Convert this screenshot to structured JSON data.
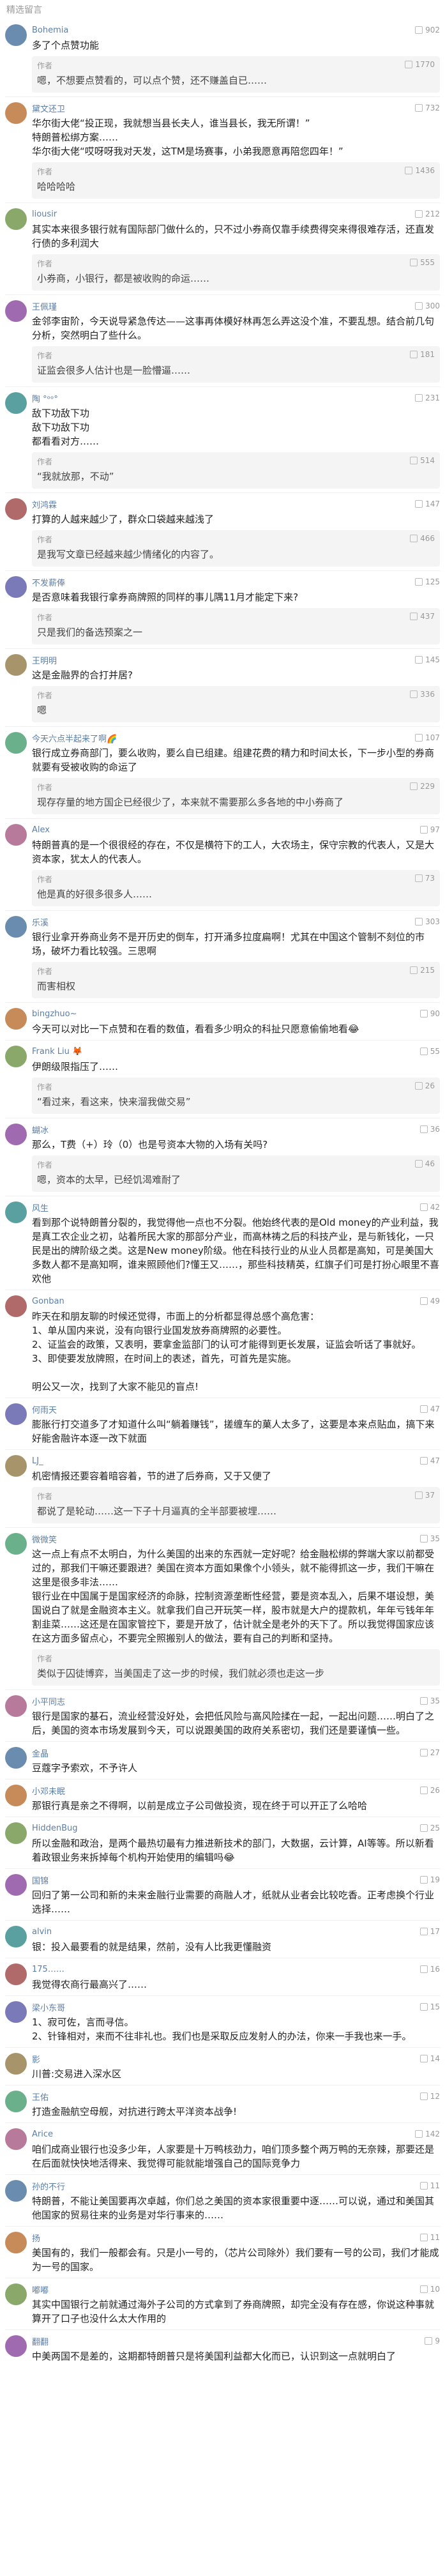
{
  "header": {
    "title": "精选留言"
  },
  "author_label": "作者",
  "comments": [
    {
      "user": "Bohemia",
      "likes": "902",
      "text": "多了个点赞功能",
      "reply": {
        "likes": "1770",
        "text": "嗯，不想要点赞看的，可以点个赞，还不赚盖自已……"
      }
    },
    {
      "user": "黛文还卫",
      "likes": "732",
      "text": "华尔街大佬“投正现，我就想当县长夫人，谁当县长，我无所谓！”\n特朗普松绑方案……\n华尔街大佬“哎呀呀我对天发，这TM是场赛事，小弟我愿意再陪您四年！”",
      "reply": {
        "likes": "1436",
        "text": "哈哈哈哈"
      }
    },
    {
      "user": "liousir",
      "likes": "212",
      "text": "其实本来很多银行就有国际部门做什么的，只不过小券商仅靠手续费得突来得很难存活，还直发行债的多利润大",
      "reply": {
        "likes": "555",
        "text": "小券商，小银行，都是被收购的命运……"
      }
    },
    {
      "user": "王佩瑾",
      "likes": "300",
      "text": "金邻李宙阶，今天说导紧急传达——这事再体模好林再怎么弄这没个准，不要乱想。结合前几句分析，突然明白了些什么。",
      "reply": {
        "likes": "181",
        "text": "证监会很多人估计也是一脸懵逼……"
      }
    },
    {
      "user": "陶 °ᵒᵒ°",
      "likes": "231",
      "text": "敌下功敌下功\n敌下功敌下功\n都看看对方……",
      "reply": {
        "likes": "514",
        "text": "“我就放那，不动”"
      }
    },
    {
      "user": "刘鸿霖",
      "likes": "147",
      "text": "打算的人越来越少了，群众口袋越来越浅了",
      "reply": {
        "likes": "466",
        "text": "是我写文章已经越来越少情绪化的内容了。"
      }
    },
    {
      "user": "不发薪俸",
      "likes": "125",
      "text": "是否意味着我银行拿券商牌照的同样的事儿隅11月才能定下来?",
      "reply": {
        "likes": "437",
        "text": "只是我们的备选预案之一"
      }
    },
    {
      "user": "王明明",
      "likes": "145",
      "text": "这是金融界的合打并居?",
      "reply": {
        "likes": "336",
        "text": "嗯"
      }
    },
    {
      "user": "今天六点半起来了啊🌈",
      "likes": "107",
      "text": "银行成立券商部门，要么收购，要么自已组建。组建花费的精力和时间太长，下一步小型的券商就要有受被收购的命运了",
      "reply": {
        "likes": "229",
        "text": "现存存量的地方国企已经很少了，本来就不需要那么多各地的中小券商了"
      }
    },
    {
      "user": "Alex",
      "likes": "97",
      "text": "特朗普真的是一个很很经的存在，不仅是横符下的工人，大农场主，保守宗教的代表人，又是大资本家，犹太人的代表人。",
      "reply": {
        "likes": "73",
        "text": "他是真的好很多很多人……"
      }
    },
    {
      "user": "乐溪",
      "likes": "303",
      "text": "银行业拿开券商业务不是开历史的倒车，打开涌多拉度扁啊！尤其在中国这个管制不刻位的市场，破坏力看比较强。三思啊",
      "reply": {
        "likes": "215",
        "text": "而害相权"
      }
    },
    {
      "user": "bingzhuo~",
      "likes": "90",
      "text": "今天可以对比一下点赞和在看的数值，看看多少明众的科扯只愿意偷偷地看😂",
      "reply": null
    },
    {
      "user": "Frank Liu 🦊",
      "likes": "55",
      "text": "伊朗级限指压了……",
      "reply": {
        "likes": "26",
        "text": "“看过来，看这来，快来溜我做交易”"
      }
    },
    {
      "user": "蝴冰",
      "likes": "36",
      "text": "那么，T费（+）玲（0）也是号资本大物的入场有关吗?",
      "reply": {
        "likes": "46",
        "text": "嗯，资本的太早，已经饥渴难耐了"
      }
    },
    {
      "user": "风生",
      "likes": "42",
      "text": "看到那个说特朗普分裂的，我觉得他一点也不分裂。他始终代表的是Old money的产业利益，我是真工农企业之初，站着所民大家的那部分产业，而高林祷之后的科技产业，是与新钱化，一只民是出的牌阶级之类。这是New money阶级。他在科技行业的从业人员都是高知，可是美国大多数人都不是高知啊，谁来照顾他们?懂王又……，那些科技精英，红旗子们可是打扮心眼里不喜欢他",
      "reply": null
    },
    {
      "user": "Gonban",
      "likes": "49",
      "text": "昨天在和朋友聊的时候还觉得，市面上的分析都显得总感个高危害：\n1、单从国内来说，没有向银行业国发放券商牌照的必要性。\n2、证监会的政策，又表明，要拿金监部门的认可才能得到更长发展，证监会听话了事就好。\n3、即使要发放牌照，在时间上的表述，首先，可首先是实施。\n\n明公又一次，找到了大家不能见的盲点!",
      "reply": null
    },
    {
      "user": "何雨天",
      "likes": "47",
      "text": "膨胀行打交道多了才知道什么叫“躺着赚钱”，搓缠车的菓人太多了，这要是本来点贴血，搞下来好能舍融许本逐一改下就面",
      "reply": null
    },
    {
      "user": "LJ_",
      "likes": "47",
      "text": "机密情报还要容着暗容着，节的进了后券商，又于又便了",
      "reply": {
        "likes": "37",
        "text": "都说了是轮动……这一下子十月逼真的全半部要被埋……"
      }
    },
    {
      "user": "微微笑",
      "likes": "35",
      "text": "这一点上有点不太明白，为什么美国的出来的东西就一定好呢？给金融松绑的弊端大家以前都受过的，那我们干嘛还要跟进？美国在资本方面如果像个小领头，就不能得抓这一步，我们干嘛在这里是很多非法……\n银行业在中国属于是国家经济的命脉，控制资源垄断性经营，要是资本乱入，后果不堪设想，美国说白了就是金融资本主义。就拿我们自己开玩笑一样，股市就是大户的提款机，年年亏钱年年割韭菜……这还是在国家管控下，要是开放了，估计就全是老外的天下了。所以我觉得国家应该在这方面多留点心，不要完全照搬别人的做法，要有自己的判断和坚持。",
      "reply": {
        "likes": "",
        "text": "类似于囚徒博弈，当美国走了这一步的时候，我们就必须也走这一步"
      }
    },
    {
      "user": "小平同志",
      "likes": "35",
      "text": "银行是国家的基石，流业经营没好处，会把低风险与高风险揉在一起，一起出问题……明白了之后，美国的资本市场发展到今天，可以说跟美国的政府关系密切，我们还是要谨慎一些。",
      "reply": null
    },
    {
      "user": "金晶",
      "likes": "27",
      "text": "豆蔻字予索欢，不予许人",
      "reply": null
    },
    {
      "user": "小邓未眠",
      "likes": "26",
      "text": "那银行真是亲之不得啊，以前是成立子公司做投资，现在终于可以开正了么哈哈",
      "reply": null
    },
    {
      "user": "HiddenBug",
      "likes": "25",
      "text": "所以金融和政治，是两个最热切最有力推进新技术的部门，大数据，云计算，AI等等。所以新看着政银业务来拆掉每个机构开始使用的编辑吗😂",
      "reply": null
    },
    {
      "user": "国锦",
      "likes": "19",
      "text": "回归了第一公司和新的未来金融行业需要的商融人才，纸就从业者会比较吃香。正考虑换个行业选择……",
      "reply": null
    },
    {
      "user": "alvin",
      "likes": "17",
      "text": "银：投入最要看的就是结果，然前，没有人比我更懂融资",
      "reply": null
    },
    {
      "user": "175……",
      "likes": "16",
      "text": "我觉得农商行最高兴了……",
      "reply": null
    },
    {
      "user": "梁小东哥",
      "likes": "15",
      "text": "1、寂可佐，言而寻信。\n2、针锋相对，来而不往非礼也。我们也是采取反应发射人的办法，你来一手我也来一手。",
      "reply": null
    },
    {
      "user": "影",
      "likes": "14",
      "text": "川普:交易进入深水区",
      "reply": null
    },
    {
      "user": "王佑",
      "likes": "12",
      "text": "打造金融航空母舰，对抗进行跨太平洋资本战争!",
      "reply": null
    },
    {
      "user": "Arice",
      "likes": "142",
      "text": "咱们成商业银行也没多少年，人家要是十万鸭核劲力，咱们顶多整个两万鸭的无奈辣，那要还是在后面就快快地活得来、我觉得可能就能增强自己的国际竞争力",
      "reply": null
    },
    {
      "user": "孙的不行",
      "likes": "11",
      "text": "特朗普，不能让美国要再次卓越，你们总之美国的资本家很重要中逐……可以说，通过和美国其他国家的贸易往来的业务是对华行事来的……",
      "reply": null
    },
    {
      "user": "扬",
      "likes": "11",
      "text": "美国有的，我们一般都会有。只是小一号的，（芯片公司除外）我们要有一号的公司，我们才能成为一号的国家。",
      "reply": null
    },
    {
      "user": "嘟嘟",
      "likes": "10",
      "text": "其实中国银行之前就通过海外子公司的方式拿到了券商牌照，却完全没有存在感，你说这种事就算开了口子也没什么太大作用的",
      "reply": null
    },
    {
      "user": "翻翻",
      "likes": "9",
      "text": "中美两国不是差的，这期都特朗普只是将美国利益都大化而已，认识到这一点就明白了",
      "reply": null
    }
  ]
}
